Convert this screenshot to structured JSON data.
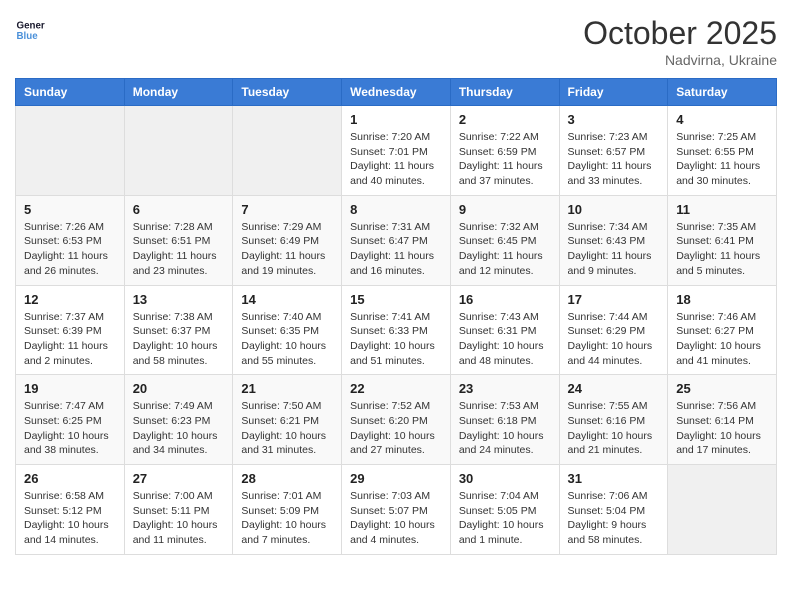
{
  "header": {
    "logo_general": "General",
    "logo_blue": "Blue",
    "month_title": "October 2025",
    "subtitle": "Nadvirna, Ukraine"
  },
  "days_of_week": [
    "Sunday",
    "Monday",
    "Tuesday",
    "Wednesday",
    "Thursday",
    "Friday",
    "Saturday"
  ],
  "weeks": [
    [
      {
        "day": "",
        "info": ""
      },
      {
        "day": "",
        "info": ""
      },
      {
        "day": "",
        "info": ""
      },
      {
        "day": "1",
        "info": "Sunrise: 7:20 AM\nSunset: 7:01 PM\nDaylight: 11 hours and 40 minutes."
      },
      {
        "day": "2",
        "info": "Sunrise: 7:22 AM\nSunset: 6:59 PM\nDaylight: 11 hours and 37 minutes."
      },
      {
        "day": "3",
        "info": "Sunrise: 7:23 AM\nSunset: 6:57 PM\nDaylight: 11 hours and 33 minutes."
      },
      {
        "day": "4",
        "info": "Sunrise: 7:25 AM\nSunset: 6:55 PM\nDaylight: 11 hours and 30 minutes."
      }
    ],
    [
      {
        "day": "5",
        "info": "Sunrise: 7:26 AM\nSunset: 6:53 PM\nDaylight: 11 hours and 26 minutes."
      },
      {
        "day": "6",
        "info": "Sunrise: 7:28 AM\nSunset: 6:51 PM\nDaylight: 11 hours and 23 minutes."
      },
      {
        "day": "7",
        "info": "Sunrise: 7:29 AM\nSunset: 6:49 PM\nDaylight: 11 hours and 19 minutes."
      },
      {
        "day": "8",
        "info": "Sunrise: 7:31 AM\nSunset: 6:47 PM\nDaylight: 11 hours and 16 minutes."
      },
      {
        "day": "9",
        "info": "Sunrise: 7:32 AM\nSunset: 6:45 PM\nDaylight: 11 hours and 12 minutes."
      },
      {
        "day": "10",
        "info": "Sunrise: 7:34 AM\nSunset: 6:43 PM\nDaylight: 11 hours and 9 minutes."
      },
      {
        "day": "11",
        "info": "Sunrise: 7:35 AM\nSunset: 6:41 PM\nDaylight: 11 hours and 5 minutes."
      }
    ],
    [
      {
        "day": "12",
        "info": "Sunrise: 7:37 AM\nSunset: 6:39 PM\nDaylight: 11 hours and 2 minutes."
      },
      {
        "day": "13",
        "info": "Sunrise: 7:38 AM\nSunset: 6:37 PM\nDaylight: 10 hours and 58 minutes."
      },
      {
        "day": "14",
        "info": "Sunrise: 7:40 AM\nSunset: 6:35 PM\nDaylight: 10 hours and 55 minutes."
      },
      {
        "day": "15",
        "info": "Sunrise: 7:41 AM\nSunset: 6:33 PM\nDaylight: 10 hours and 51 minutes."
      },
      {
        "day": "16",
        "info": "Sunrise: 7:43 AM\nSunset: 6:31 PM\nDaylight: 10 hours and 48 minutes."
      },
      {
        "day": "17",
        "info": "Sunrise: 7:44 AM\nSunset: 6:29 PM\nDaylight: 10 hours and 44 minutes."
      },
      {
        "day": "18",
        "info": "Sunrise: 7:46 AM\nSunset: 6:27 PM\nDaylight: 10 hours and 41 minutes."
      }
    ],
    [
      {
        "day": "19",
        "info": "Sunrise: 7:47 AM\nSunset: 6:25 PM\nDaylight: 10 hours and 38 minutes."
      },
      {
        "day": "20",
        "info": "Sunrise: 7:49 AM\nSunset: 6:23 PM\nDaylight: 10 hours and 34 minutes."
      },
      {
        "day": "21",
        "info": "Sunrise: 7:50 AM\nSunset: 6:21 PM\nDaylight: 10 hours and 31 minutes."
      },
      {
        "day": "22",
        "info": "Sunrise: 7:52 AM\nSunset: 6:20 PM\nDaylight: 10 hours and 27 minutes."
      },
      {
        "day": "23",
        "info": "Sunrise: 7:53 AM\nSunset: 6:18 PM\nDaylight: 10 hours and 24 minutes."
      },
      {
        "day": "24",
        "info": "Sunrise: 7:55 AM\nSunset: 6:16 PM\nDaylight: 10 hours and 21 minutes."
      },
      {
        "day": "25",
        "info": "Sunrise: 7:56 AM\nSunset: 6:14 PM\nDaylight: 10 hours and 17 minutes."
      }
    ],
    [
      {
        "day": "26",
        "info": "Sunrise: 6:58 AM\nSunset: 5:12 PM\nDaylight: 10 hours and 14 minutes."
      },
      {
        "day": "27",
        "info": "Sunrise: 7:00 AM\nSunset: 5:11 PM\nDaylight: 10 hours and 11 minutes."
      },
      {
        "day": "28",
        "info": "Sunrise: 7:01 AM\nSunset: 5:09 PM\nDaylight: 10 hours and 7 minutes."
      },
      {
        "day": "29",
        "info": "Sunrise: 7:03 AM\nSunset: 5:07 PM\nDaylight: 10 hours and 4 minutes."
      },
      {
        "day": "30",
        "info": "Sunrise: 7:04 AM\nSunset: 5:05 PM\nDaylight: 10 hours and 1 minute."
      },
      {
        "day": "31",
        "info": "Sunrise: 7:06 AM\nSunset: 5:04 PM\nDaylight: 9 hours and 58 minutes."
      },
      {
        "day": "",
        "info": ""
      }
    ]
  ]
}
